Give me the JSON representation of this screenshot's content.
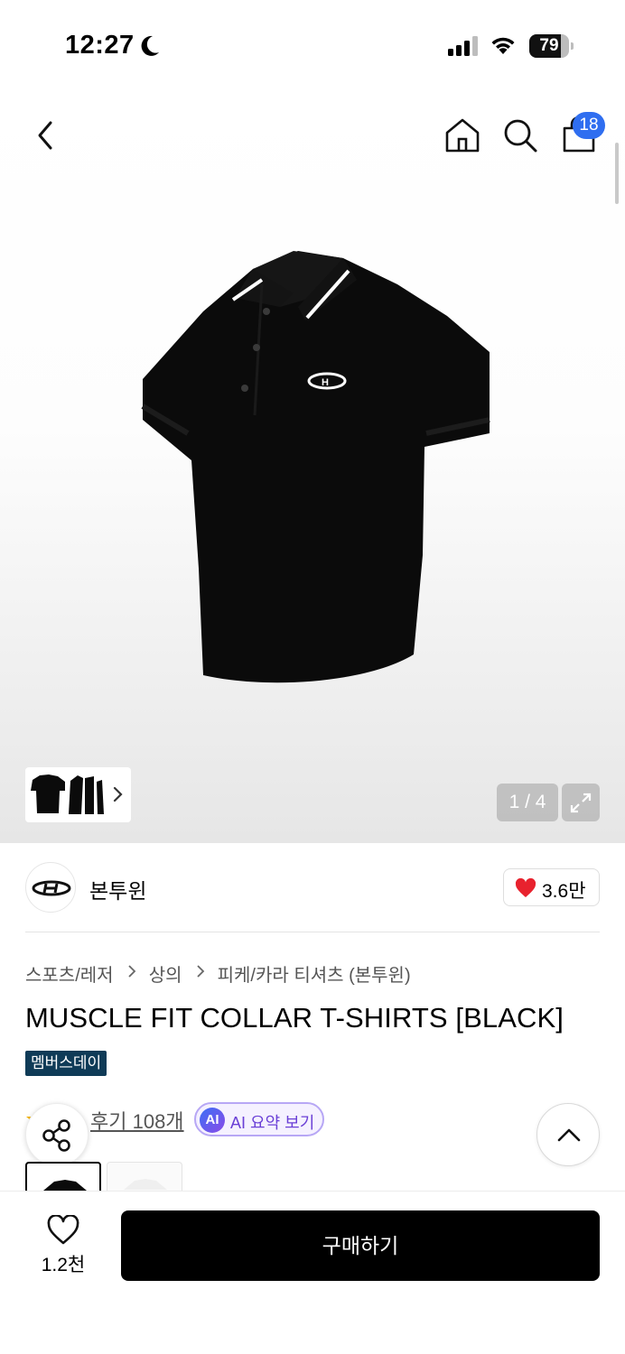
{
  "status_bar": {
    "time": "12:27",
    "battery_level": "79",
    "battery_fraction": 0.79,
    "icons": [
      "moon-icon",
      "signal-icon",
      "wifi-icon",
      "battery-icon"
    ]
  },
  "nav": {
    "icons": [
      "back-arrow-icon",
      "home-icon",
      "search-icon",
      "shopping-bag-icon"
    ],
    "cart_count": "18"
  },
  "gallery": {
    "counter": "1 / 4",
    "icons": [
      "chevron-right-icon",
      "expand-icon"
    ]
  },
  "brand": {
    "name": "본투윈",
    "likes": "3.6만",
    "heart_color": "#e8222e"
  },
  "breadcrumb": {
    "items": [
      "스포츠/레저",
      "상의",
      "피케/카라 티셔츠 (본투윈)"
    ]
  },
  "product": {
    "title": "MUSCLE FIT COLLAR T-SHIRTS [BLACK]",
    "badge": "멤버스데이",
    "badge_color": "#0f3b57"
  },
  "reviews": {
    "label": "후기 108개",
    "ai_icon_text": "AI",
    "ai_label": "AI 요약 보기"
  },
  "bottom_bar": {
    "wish_count": "1.2천",
    "buy_label": "구매하기"
  }
}
